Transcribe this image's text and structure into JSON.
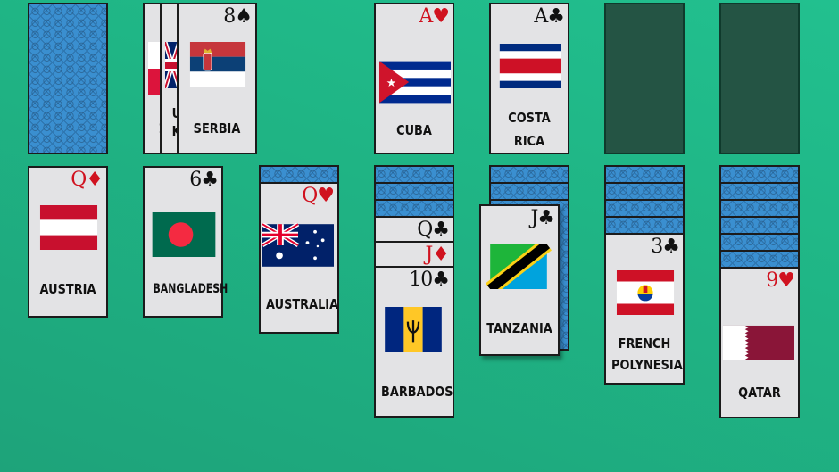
{
  "game": "Solitaire (Klondike) — country flags theme",
  "colors": {
    "background": "#1fb585",
    "empty_slot": "#245444",
    "card_face": "#e3e3e5",
    "card_back": "#3a8fd0",
    "red_suit": "#d0121f",
    "black_suit": "#111111"
  },
  "stock": {
    "face_down": true
  },
  "waste": {
    "cards": [
      {
        "country": "?",
        "partial": true
      },
      {
        "country": "United Kingdom",
        "partial": true
      },
      {
        "rank": "8",
        "suit": "spade-icon",
        "suit_glyph": "♠",
        "country": "SERBIA"
      }
    ]
  },
  "foundations": [
    {
      "rank": "A",
      "suit": "heart-icon",
      "suit_glyph": "♥",
      "country": "CUBA"
    },
    {
      "rank": "A",
      "suit": "club-icon",
      "suit_glyph": "♣",
      "country_lines": [
        "COSTA",
        "RICA"
      ]
    },
    {
      "empty": true
    },
    {
      "empty": true
    }
  ],
  "tableau": [
    {
      "face_down": 0,
      "face_up": [
        {
          "rank": "Q",
          "suit_glyph": "♦",
          "color": "red",
          "country": "AUSTRIA"
        }
      ]
    },
    {
      "face_down": 0,
      "face_up": [
        {
          "rank": "6",
          "suit_glyph": "♣",
          "color": "black",
          "country": "BANGLADESH"
        }
      ]
    },
    {
      "face_down": 1,
      "face_up": [
        {
          "rank": "Q",
          "suit_glyph": "♥",
          "color": "red",
          "country": "AUSTRALIA"
        }
      ]
    },
    {
      "face_down": 3,
      "face_up": [
        {
          "rank": "Q",
          "suit_glyph": "♣",
          "color": "black"
        },
        {
          "rank": "J",
          "suit_glyph": "♦",
          "color": "red"
        },
        {
          "rank": "10",
          "suit_glyph": "♣",
          "color": "black",
          "country": "BARBADOS"
        }
      ]
    },
    {
      "face_down": 4,
      "face_up": [
        {
          "rank": "J",
          "suit_glyph": "♣",
          "color": "black",
          "country": "TANZANIA",
          "dragging": true
        }
      ]
    },
    {
      "face_down": 4,
      "face_up": [
        {
          "rank": "3",
          "suit_glyph": "♣",
          "color": "black",
          "country_lines": [
            "FRENCH",
            "POLYNESIA"
          ]
        }
      ]
    },
    {
      "face_down": 6,
      "face_up": [
        {
          "rank": "9",
          "suit_glyph": "♥",
          "color": "red",
          "country": "QATAR"
        }
      ]
    }
  ]
}
